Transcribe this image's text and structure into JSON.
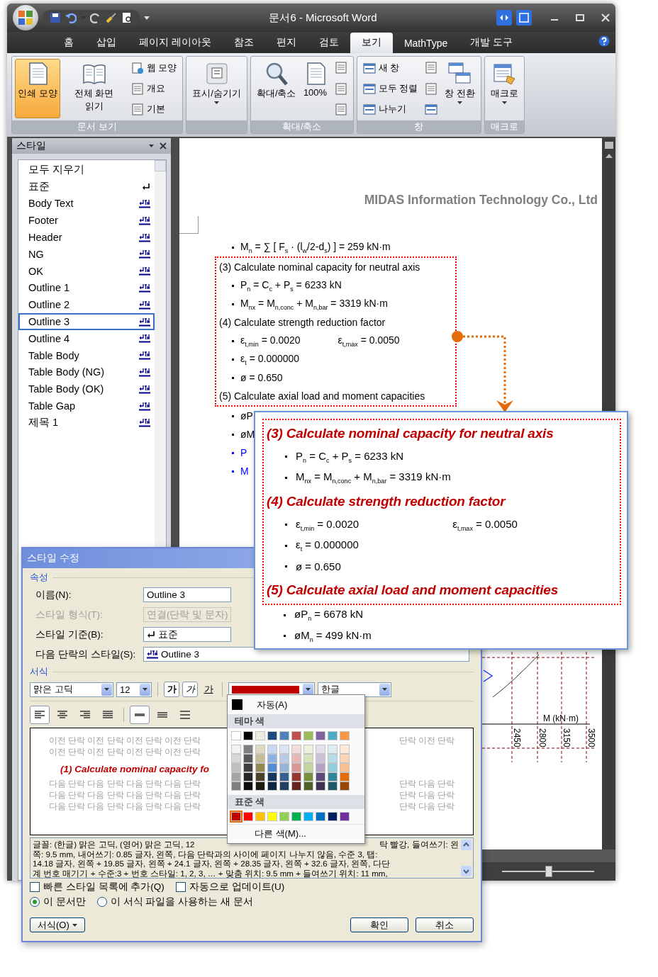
{
  "window": {
    "title": "문서6 - Microsoft Word"
  },
  "ribbon_tabs": [
    {
      "label": "홈",
      "selected": false
    },
    {
      "label": "삽입",
      "selected": false
    },
    {
      "label": "페이지 레이아웃",
      "selected": false
    },
    {
      "label": "참조",
      "selected": false
    },
    {
      "label": "편지",
      "selected": false
    },
    {
      "label": "검토",
      "selected": false
    },
    {
      "label": "보기",
      "selected": true
    },
    {
      "label": "MathType",
      "selected": false
    },
    {
      "label": "개발 도구",
      "selected": false
    }
  ],
  "ribbon_groups": [
    {
      "label": "문서 보기",
      "items": [
        {
          "kind": "large",
          "label": "인쇄 모양",
          "selected": true
        },
        {
          "kind": "large",
          "label": "전체 화면 읽기",
          "selected": false
        },
        {
          "kind": "small",
          "label": "웹 모양",
          "selected": false
        },
        {
          "kind": "small",
          "label": "개요",
          "selected": false
        },
        {
          "kind": "small",
          "label": "기본",
          "selected": false
        }
      ]
    },
    {
      "items": [
        {
          "kind": "large",
          "label": "표시/숨기기",
          "dropdown": true
        }
      ]
    },
    {
      "label": "확대/축소",
      "items": [
        {
          "kind": "large",
          "label": "확대/축소"
        },
        {
          "kind": "large",
          "label": "100%"
        },
        {
          "kind": "icon"
        },
        {
          "kind": "icon"
        },
        {
          "kind": "icon"
        }
      ]
    },
    {
      "label": "창",
      "items": [
        {
          "kind": "small",
          "label": "새 창"
        },
        {
          "kind": "small",
          "label": "모두 정렬"
        },
        {
          "kind": "small",
          "label": "나누기"
        },
        {
          "kind": "icon"
        },
        {
          "kind": "icon"
        },
        {
          "kind": "icon"
        },
        {
          "kind": "large",
          "label": "창 전환",
          "dropdown": true
        }
      ]
    },
    {
      "label": "매크로",
      "items": [
        {
          "kind": "large",
          "label": "매크로",
          "dropdown": true
        }
      ]
    }
  ],
  "styles_pane": {
    "title": "스타일",
    "items": [
      {
        "kind": "clear",
        "label": "모두 지우기",
        "selected": false
      },
      {
        "kind": "paragraph",
        "label": "표준",
        "selected": false
      },
      {
        "kind": "linked",
        "label": "Body Text",
        "selected": false
      },
      {
        "kind": "linked",
        "label": "Footer",
        "selected": false
      },
      {
        "kind": "linked",
        "label": "Header",
        "selected": false
      },
      {
        "kind": "linked",
        "label": "NG",
        "selected": false
      },
      {
        "kind": "linked",
        "label": "OK",
        "selected": false
      },
      {
        "kind": "linked",
        "label": "Outline 1",
        "selected": false
      },
      {
        "kind": "linked",
        "label": "Outline 2",
        "selected": false
      },
      {
        "kind": "linked",
        "label": "Outline 3",
        "selected": true
      },
      {
        "kind": "linked",
        "label": "Outline 4",
        "selected": false
      },
      {
        "kind": "linked",
        "label": "Table Body",
        "selected": false
      },
      {
        "kind": "linked",
        "label": "Table Body (NG)",
        "selected": false
      },
      {
        "kind": "linked",
        "label": "Table Body (OK)",
        "selected": false
      },
      {
        "kind": "linked",
        "label": "Table Gap",
        "selected": false
      },
      {
        "kind": "linked",
        "label": "제목 1",
        "selected": false
      }
    ]
  },
  "document": {
    "header": "MIDAS Information Technology Co., Ltd",
    "lines_before": [
      {
        "kind": "bullet",
        "text": "M$_{n}$ = ∑ [ F$_{s}$ · (l$_{w}$/2-d$_{s}$) ] = 259 kN·m"
      }
    ],
    "boxed_lines": [
      {
        "kind": "heading",
        "text": "(3) Calculate nominal capacity for neutral axis"
      },
      {
        "kind": "bullet",
        "text": "P$_{n}$ = C$_{c}$ + P$_{s}$ = 6233 kN"
      },
      {
        "kind": "bullet",
        "text": "M$_{nx}$ = M$_{n,conc}$ + M$_{n,bar}$ = 3319 kN·m"
      },
      {
        "kind": "heading",
        "text": "(4) Calculate strength reduction factor"
      },
      {
        "kind": "pair",
        "text": "ε$_{t,min}$ = 0.0020",
        "text_2": "ε$_{t,max}$ = 0.0050"
      },
      {
        "kind": "bullet",
        "text": "ε$_{t}$ = 0.000000"
      },
      {
        "kind": "bullet",
        "text": "ø = 0.650"
      },
      {
        "kind": "heading",
        "text": "(5) Calculate axial load and moment capacities"
      }
    ],
    "lines_after": [
      {
        "kind": "bullet",
        "text": "øP",
        "color": "#000000"
      },
      {
        "kind": "bullet",
        "text": "øM",
        "color": "#000000"
      },
      {
        "kind": "bullet",
        "text": "P",
        "color": "#0000ff"
      },
      {
        "kind": "bullet",
        "text": "M",
        "color": "#0000ff"
      }
    ],
    "chart_fragment": {
      "axis_label": "M (kN·m)",
      "tick_labels": [
        "2450",
        "2800",
        "3150",
        "3500"
      ]
    }
  },
  "zoom_slider": {
    "level": 0.5
  },
  "callout": {
    "boxed_lines": [
      {
        "kind": "heading",
        "text": "(3) Calculate nominal capacity for neutral axis"
      },
      {
        "kind": "bullet",
        "text": "P$_{n}$ = C$_{c}$ + P$_{s}$ = 6233 kN"
      },
      {
        "kind": "bullet",
        "text": "M$_{nx}$ = M$_{n,conc}$ + M$_{n,bar}$ = 3319 kN·m"
      },
      {
        "kind": "heading",
        "text": "(4) Calculate strength reduction factor"
      },
      {
        "kind": "pair",
        "text": "ε$_{t,min}$ = 0.0020",
        "text_2": "ε$_{t,max}$ = 0.0050"
      },
      {
        "kind": "bullet",
        "text": "ε$_{t}$ = 0.000000"
      },
      {
        "kind": "bullet",
        "text": "ø = 0.650"
      },
      {
        "kind": "heading",
        "text": "(5) Calculate axial load and moment capacities"
      }
    ],
    "lines_after": [
      {
        "kind": "bullet",
        "text": "øP$_{n}$ = 6678 kN"
      },
      {
        "kind": "bullet",
        "text": "øM$_{n}$ = 499 kN·m"
      }
    ]
  },
  "dialog": {
    "title": "스타일 수정",
    "properties_header": "속성",
    "fields": [
      {
        "label": "이름(N):",
        "value": "Outline 3",
        "disabled": false
      },
      {
        "label": "스타일 형식(T):",
        "value": "연결(단락 및 문자)",
        "disabled": true
      },
      {
        "label": "스타일 기준(B):",
        "value": "표준",
        "disabled": false
      },
      {
        "label": "다음 단락의 스타일(S):",
        "value": "Outline 3",
        "disabled": false
      }
    ],
    "format_header": "서식",
    "font": "맑은 고딕",
    "size": "12",
    "style_buttons": [
      {
        "label": "가",
        "kind": "bold",
        "selected": true
      },
      {
        "label": "가",
        "kind": "italic",
        "selected": true
      },
      {
        "label": "가",
        "kind": "underline",
        "selected": false
      }
    ],
    "font_color": {
      "color": "#c00000"
    },
    "script": "한글",
    "alignment_buttons": [
      {
        "selected": true
      },
      {
        "selected": false
      },
      {
        "selected": false
      },
      {
        "selected": false
      }
    ],
    "spacing_buttons": [
      {
        "selected": true
      },
      {
        "selected": false
      },
      {
        "selected": false
      }
    ],
    "preview": {
      "before": [
        {
          "text": "이전 단락 이전 단락 이전 단락 이전 단락",
          "text_2": "단락 이전 단락"
        },
        {
          "text": "이전 단락 이전 단락 이전 단락 이전 단락"
        }
      ],
      "sample": "(1) Calculate nominal capacity fo",
      "after": [
        {
          "text": "다음 단락 다음 단락 다음 단락 다음 단락",
          "text_2": "단락 다음 단락"
        },
        {
          "text": "다음 단락 다음 단락 다음 단락 다음 단락",
          "text_2": "단락 다음 단락"
        },
        {
          "text": "다음 단락 다음 단락 다음 단락 다음 단락",
          "text_2": "단락 다음 단락"
        }
      ]
    },
    "description": [
      {
        "text": "글꼴: (한글) 맑은 고딕, (영어) 맑은 고딕, 12",
        "text_2": "탁 빨강, 들여쓰기: 왼"
      },
      {
        "text": "쪽: 9.5 mm, 내어쓰기: 0.85 글자, 왼쪽, 다음 단락과의 사이에 페이지 나누지 않음, 수준 3, 탭:"
      },
      {
        "text": "14.18 글자, 왼쪽 + 19.85 글자, 왼쪽 + 24.1 글자, 왼쪽 + 28.35 글자, 왼쪽 + 32.6 글자, 왼쪽, 다단"
      },
      {
        "text": "계 번호 매기기 + 수준:3 + 번호 스타일: 1, 2, 3, … + 맞춤 위치: 9.5 mm + 들여쓰기 위치: 11 mm,"
      }
    ],
    "checkboxes": [
      {
        "label": "빠른 스타일 목록에 추가(Q)",
        "checked": false
      },
      {
        "label": "자동으로 업데이트(U)",
        "checked": false
      }
    ],
    "radios": [
      {
        "label": "이 문서만",
        "selected": true
      },
      {
        "label": "이 서식 파일을 사용하는 새 문서",
        "selected": false
      }
    ],
    "format_button": "서식(O)",
    "ok_button": "확인",
    "cancel_button": "취소"
  },
  "color_menu": {
    "auto_label": "자동(A)",
    "theme_header": "테마 색",
    "theme_colors": [
      {
        "color": "#ffffff"
      },
      {
        "color": "#000000"
      },
      {
        "color": "#eeece1"
      },
      {
        "color": "#1f497d"
      },
      {
        "color": "#4f81bd"
      },
      {
        "color": "#c0504d"
      },
      {
        "color": "#9bbb59"
      },
      {
        "color": "#8064a2"
      },
      {
        "color": "#4bacc6"
      },
      {
        "color": "#f79646"
      }
    ],
    "theme_shades": [
      [
        {
          "color": "#f2f2f2"
        },
        {
          "color": "#d8d8d8"
        },
        {
          "color": "#bfbfbf"
        },
        {
          "color": "#a5a5a5"
        },
        {
          "color": "#7f7f7f"
        }
      ],
      [
        {
          "color": "#7f7f7f"
        },
        {
          "color": "#595959"
        },
        {
          "color": "#3f3f3f"
        },
        {
          "color": "#262626"
        },
        {
          "color": "#0c0c0c"
        }
      ],
      [
        {
          "color": "#ddd9c3"
        },
        {
          "color": "#c4bd97"
        },
        {
          "color": "#938953"
        },
        {
          "color": "#494429"
        },
        {
          "color": "#1d1b10"
        }
      ],
      [
        {
          "color": "#c6d9f0"
        },
        {
          "color": "#8db3e2"
        },
        {
          "color": "#548dd4"
        },
        {
          "color": "#17365d"
        },
        {
          "color": "#0f243e"
        }
      ],
      [
        {
          "color": "#dbe5f1"
        },
        {
          "color": "#b8cce4"
        },
        {
          "color": "#95b3d7"
        },
        {
          "color": "#366092"
        },
        {
          "color": "#244061"
        }
      ],
      [
        {
          "color": "#f2dcdb"
        },
        {
          "color": "#e5b9b7"
        },
        {
          "color": "#d99694"
        },
        {
          "color": "#953734"
        },
        {
          "color": "#632423"
        }
      ],
      [
        {
          "color": "#ebf1dd"
        },
        {
          "color": "#d7e3bc"
        },
        {
          "color": "#c3d69b"
        },
        {
          "color": "#76923c"
        },
        {
          "color": "#4f6128"
        }
      ],
      [
        {
          "color": "#e5e0ec"
        },
        {
          "color": "#ccc1d9"
        },
        {
          "color": "#b2a2c7"
        },
        {
          "color": "#5f497a"
        },
        {
          "color": "#3f3151"
        }
      ],
      [
        {
          "color": "#dbeef3"
        },
        {
          "color": "#b7dde8"
        },
        {
          "color": "#92cddc"
        },
        {
          "color": "#31859b"
        },
        {
          "color": "#205867"
        }
      ],
      [
        {
          "color": "#fdeada"
        },
        {
          "color": "#fbd5b5"
        },
        {
          "color": "#fac08f"
        },
        {
          "color": "#e36c09"
        },
        {
          "color": "#974806"
        }
      ]
    ],
    "standard_header": "표준 색",
    "standard_colors": [
      {
        "color": "#c00000",
        "selected": true
      },
      {
        "color": "#ff0000",
        "selected": false
      },
      {
        "color": "#ffc000",
        "selected": false
      },
      {
        "color": "#ffff00",
        "selected": false
      },
      {
        "color": "#92d050",
        "selected": false
      },
      {
        "color": "#00b050",
        "selected": false
      },
      {
        "color": "#00b0f0",
        "selected": false
      },
      {
        "color": "#0070c0",
        "selected": false
      },
      {
        "color": "#002060",
        "selected": false
      },
      {
        "color": "#7030a0",
        "selected": false
      }
    ],
    "more_label": "다른 색(M)..."
  }
}
